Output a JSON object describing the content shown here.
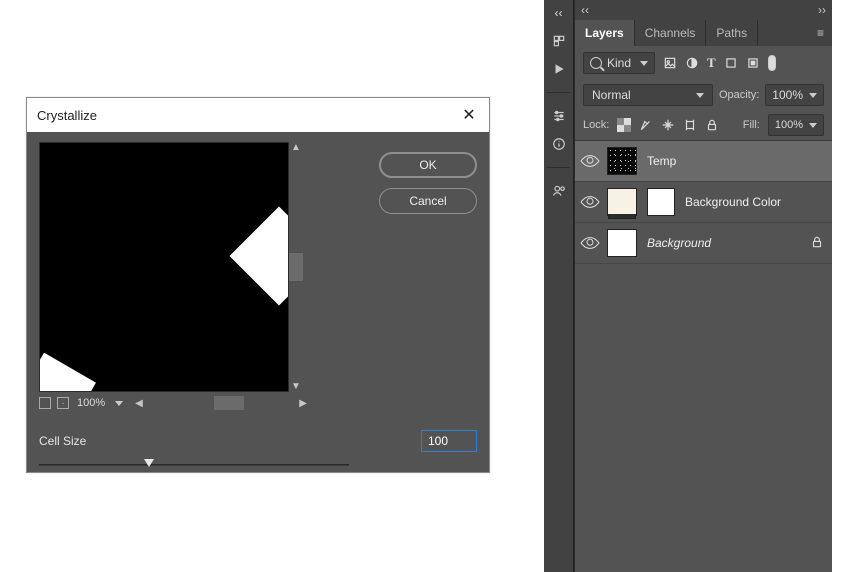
{
  "dialog": {
    "title": "Crystallize",
    "close_symbol": "✕",
    "ok_label": "OK",
    "cancel_label": "Cancel",
    "zoom_pct": "100%",
    "param_label": "Cell Size",
    "param_value": "100"
  },
  "panels": {
    "collapse_symbol": "‹‹",
    "expand_symbol": "››",
    "tabs": [
      "Layers",
      "Channels",
      "Paths"
    ],
    "active_tab": 0,
    "kind_label": "Kind",
    "blend_mode": "Normal",
    "opacity_label": "Opacity:",
    "opacity_value": "100%",
    "lock_label": "Lock:",
    "fill_label": "Fill:",
    "fill_value": "100%",
    "layers": [
      {
        "name": "Temp",
        "selected": true,
        "thumb": "noise",
        "has_mask": false,
        "locked": false,
        "italic": false
      },
      {
        "name": "Background Color",
        "selected": false,
        "thumb": "cream",
        "has_mask": true,
        "locked": false,
        "italic": false
      },
      {
        "name": "Background",
        "selected": false,
        "thumb": "white",
        "has_mask": false,
        "locked": true,
        "italic": true
      }
    ]
  }
}
